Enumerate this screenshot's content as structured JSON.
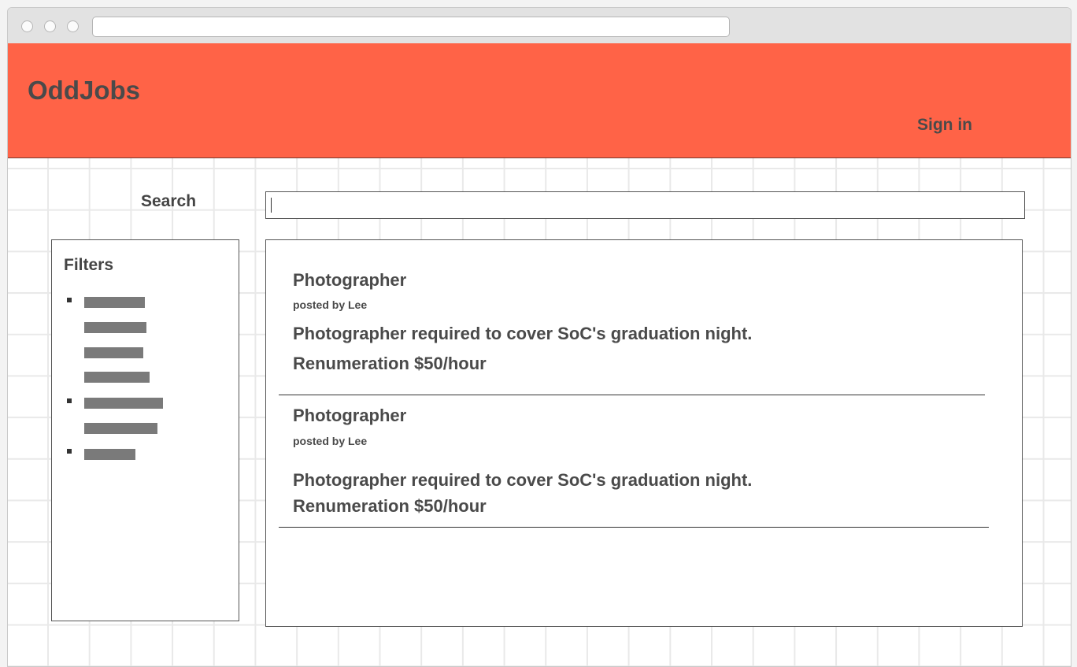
{
  "browser": {
    "address_value": ""
  },
  "header": {
    "brand": "OddJobs",
    "sign_in": "Sign in",
    "background": "#ff6347"
  },
  "search": {
    "label": "Search",
    "value": ""
  },
  "filters": {
    "title": "Filters",
    "groups": [
      {
        "item_count": 4
      },
      {
        "item_count": 2
      },
      {
        "item_count": 1
      }
    ]
  },
  "jobs": [
    {
      "title": "Photographer",
      "poster": "posted by Lee",
      "description": "Photographer required to cover SoC's graduation night.",
      "pay": "Renumeration $50/hour"
    },
    {
      "title": "Photographer",
      "poster": "posted by Lee",
      "description": "Photographer required to cover SoC's graduation night.",
      "pay": "Renumeration $50/hour"
    }
  ]
}
